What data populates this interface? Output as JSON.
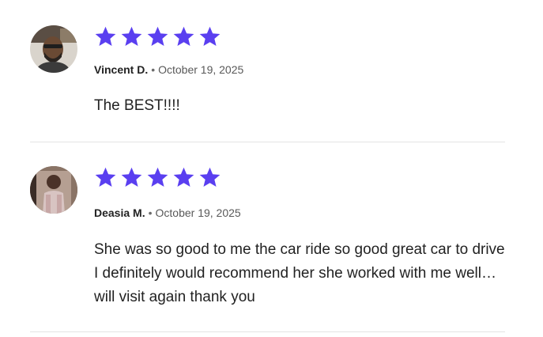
{
  "colors": {
    "star": "#5a3ff0",
    "divider": "#e4e4e4"
  },
  "reviews": [
    {
      "reviewer": "Vincent D.",
      "separator": "•",
      "date": "October 19, 2025",
      "rating": 5,
      "text": "The BEST!!!!",
      "avatar_icon": "user-photo-avatar"
    },
    {
      "reviewer": "Deasia M.",
      "separator": "•",
      "date": "October 19, 2025",
      "rating": 5,
      "text": "She was so good to me the car ride so good great car to drive I definitely would recommend her she worked with me well… will visit again thank you",
      "avatar_icon": "user-photo-avatar"
    }
  ]
}
